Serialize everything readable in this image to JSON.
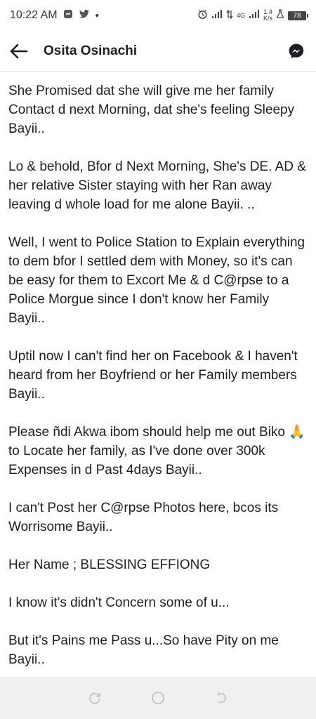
{
  "status_bar": {
    "time": "10:22 AM",
    "dot": "•",
    "network_type": "4G",
    "speed_value": "1.4",
    "speed_unit": "K/s",
    "battery": "78"
  },
  "app_bar": {
    "title": "Osita Osinachi",
    "back_icon": "arrow-left-icon",
    "messenger_icon": "messenger-icon"
  },
  "post": {
    "paragraphs": [
      "She Promised dat she will give me her family Contact d next Morning, dat she's feeling Sleepy Bayii..",
      "Lo & behold, Bfor d Next Morning, She's DE. AD & her relative Sister staying with her Ran away leaving d whole load for me alone Bayii. ..",
      "Well, I went to Police Station to Explain everything to dem bfor I settled dem with Money, so it's can be easy for them to Excort Me & d C@rpse to a Police Morgue since I don't know her Family Bayii..",
      "Uptil now I can't find her on Facebook & I haven't heard from her Boyfriend or her Family members Bayii..",
      "Please ñdi Akwa ibom should help me out Biko 🙏 to Locate her family, as I've done over 300k Expenses in d Past 4days Bayii..",
      "I can't Post her C@rpse Photos here, bcos its Worrisome Bayii..",
      "Her Name ; BLESSING EFFIONG",
      "I know it's didn't Concern some of u...",
      "But it's Pains me Pass u...So have Pity on me Bayii.."
    ]
  },
  "nav_bar": {
    "icons": [
      "recent-apps-icon",
      "home-icon",
      "back-icon"
    ]
  }
}
